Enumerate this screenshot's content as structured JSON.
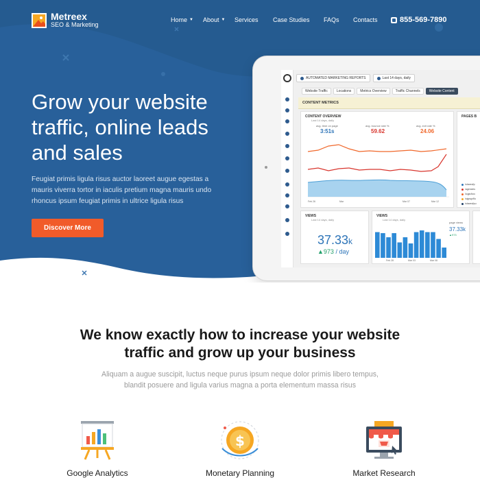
{
  "brand": {
    "name": "Metreex",
    "tagline": "SEO & Marketing"
  },
  "nav": {
    "items": [
      {
        "label": "Home",
        "dropdown": true
      },
      {
        "label": "About",
        "dropdown": true
      },
      {
        "label": "Services",
        "dropdown": false
      },
      {
        "label": "Case Studies",
        "dropdown": false
      },
      {
        "label": "FAQs",
        "dropdown": false
      },
      {
        "label": "Contacts",
        "dropdown": false
      }
    ],
    "phone": "855-569-7890"
  },
  "hero": {
    "title": "Grow your website traffic, online leads and sales",
    "description": "Feugiat primis ligula risus auctor laoreet augue egestas a mauris viverra tortor in iaculis pretium magna mauris undo rhoncus ipsum feugiat primis in ultrice ligula risus",
    "cta_label": "Discover More"
  },
  "dashboard": {
    "report_select": "AUTOMATED MARKETING REPORTS",
    "date_select": "Last 14 days, daily",
    "tabs": [
      "Website Traffic",
      "Locations",
      "Metrics Overview",
      "Traffic Channels",
      "Website Content"
    ],
    "active_tab": "Website Content",
    "banner": "CONTENT METRICS",
    "overview": {
      "title": "CONTENT OVERVIEW",
      "subtitle": "Last 14 days, daily",
      "metrics": [
        {
          "label": "avg. time on page",
          "value": "3:51s"
        },
        {
          "label": "avg. bounce rate %",
          "value": "59.62"
        },
        {
          "label": "avg. exit rate %",
          "value": "24.06"
        }
      ],
      "x_labels": [
        "Feb 26",
        "Mar",
        "Mar 07",
        "Mar 12"
      ]
    },
    "pages_card_title": "PAGES B",
    "legend": [
      "/shared/p",
      "/agencies",
      "/login/forc",
      "/signup/flo",
      "/shared/pu"
    ],
    "views_card": {
      "title": "VIEWS",
      "subtitle": "Last 14 days, daily",
      "value": "37.33",
      "value_unit": "k",
      "change": "973",
      "change_suffix": " / day"
    },
    "views_chart": {
      "title": "VIEWS",
      "subtitle": "Last 14 days, daily",
      "side_label": "page views",
      "side_value": "37.33k",
      "side_change": "973",
      "x_labels": [
        "Feb 28",
        "Mar 03",
        "Mar 08"
      ],
      "bar_values": [
        0.75,
        0.72,
        0.6,
        0.72,
        0.45,
        0.6,
        0.42,
        0.75,
        0.8,
        0.75,
        0.75,
        0.55,
        0.3
      ]
    }
  },
  "section": {
    "title_line1": "We know exactly how to increase your website",
    "title_line2": "traffic and grow up your business",
    "desc_line1": "Aliquam a augue suscipit, luctus neque purus ipsum neque dolor primis libero tempus,",
    "desc_line2": "blandit posuere and ligula varius magna a porta elementum massa risus"
  },
  "features": [
    {
      "label": "Google Analytics",
      "icon": "presentation-board-icon"
    },
    {
      "label": "Monetary Planning",
      "icon": "dollar-coin-icon"
    },
    {
      "label": "Market Research",
      "icon": "online-shop-icon"
    }
  ],
  "colors": {
    "hero_bg": "#28609a",
    "hero_bg_dark": "#1f4f82",
    "cta": "#f15b2a",
    "accent_blue": "#2d74b8",
    "bounce_red": "#d8342c",
    "exit_orange": "#f0672a"
  }
}
